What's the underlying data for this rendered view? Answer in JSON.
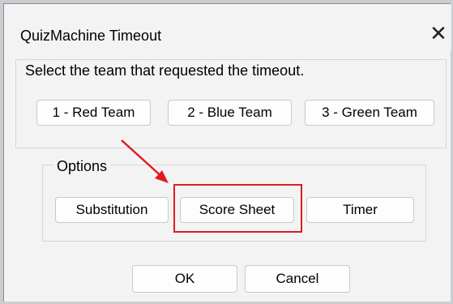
{
  "window": {
    "title": "QuizMachine Timeout",
    "close_symbol": "✕"
  },
  "team_group": {
    "prompt": "Select the team that requested the timeout.",
    "buttons": [
      "1 - Red Team",
      "2 - Blue Team",
      "3 - Green Team"
    ]
  },
  "options_group": {
    "label": "Options",
    "buttons": [
      "Substitution",
      "Score Sheet",
      "Timer"
    ]
  },
  "footer": {
    "ok_label": "OK",
    "cancel_label": "Cancel"
  },
  "annotation": {
    "highlight_color": "#e01b24",
    "arrow_color": "#e01b24",
    "highlighted_element": "Score Sheet"
  }
}
